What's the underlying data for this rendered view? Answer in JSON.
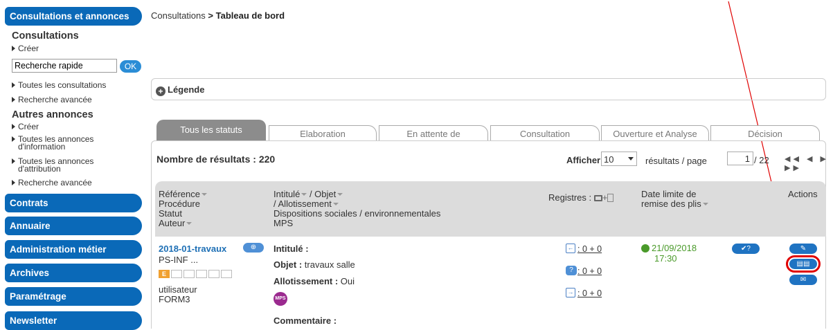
{
  "sidebar": {
    "consultations_btn": "Consultations et annonces",
    "consultations_heading": "Consultations",
    "creer1": "Créer",
    "search_placeholder": "Recherche rapide",
    "search_ok": "OK",
    "toutes_consultations": "Toutes les consultations",
    "recherche_avancee1": "Recherche avancée",
    "autres_heading": "Autres annonces",
    "creer2": "Créer",
    "annonces_info_1": "Toutes les annonces",
    "annonces_info_2": "d'information",
    "annonces_attr_1": "Toutes les annonces",
    "annonces_attr_2": "d'attribution",
    "recherche_avancee2": "Recherche avancée",
    "contrats": "Contrats",
    "annuaire": "Annuaire",
    "administration": "Administration métier",
    "archives": "Archives",
    "parametrage": "Paramétrage",
    "newsletter": "Newsletter"
  },
  "breadcrumb": {
    "parent": "Consultations",
    "sep": " > ",
    "current": "Tableau de bord"
  },
  "legend": {
    "label": "Légende"
  },
  "tabs": [
    "Tous les statuts",
    "Elaboration",
    "En attente de",
    "Consultation",
    "Ouverture et Analyse",
    "Décision"
  ],
  "results": {
    "count_label": "Nombre de résultats : 220",
    "show_label": "Afficher",
    "per_page": "10",
    "per_page_label": "résultats / page",
    "page": "1",
    "total_pages": "/ 22"
  },
  "headers": {
    "reference": "Référence",
    "procedure": "Procédure",
    "statut": "Statut",
    "auteur": "Auteur",
    "intitule": "Intitulé",
    "objet": "/ Objet",
    "allotissement": "/ Allotissement",
    "dispositions": "Dispositions sociales / environnementales",
    "mps": "MPS",
    "registres": "Registres :",
    "date_limite_1": "Date limite de",
    "date_limite_2": "remise des plis",
    "actions": "Actions"
  },
  "row": {
    "reference": "2018-01-travaux",
    "procedure": "PS-INF ...",
    "statut_badge": "E",
    "auteur_1": "utilisateur",
    "auteur_2": "FORM3",
    "intitule_label": "Intitulé :",
    "objet_label": "Objet :",
    "objet_value": " travaux salle",
    "allot_label": "Allotissement :",
    "allot_value": " Oui",
    "mps_badge": "MPS",
    "commentaire_label": "Commentaire :",
    "reg1": ": 0 + 0",
    "reg2": ": 0 + 0",
    "reg3": ": 0 + 0",
    "date": "21/09/2018",
    "time": "17:30"
  },
  "colors": {
    "accent": "#0a69b8",
    "date_green": "#4a9a2a",
    "highlight": "#e00000",
    "badge_orange": "#f0a030",
    "mps_purple": "#9b2a8f"
  }
}
